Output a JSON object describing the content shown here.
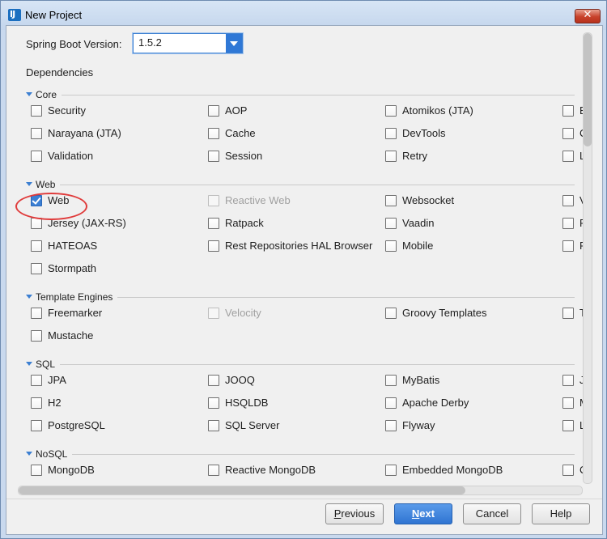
{
  "window": {
    "title": "New Project",
    "icon": "intellij-icon",
    "close_glyph": "✕"
  },
  "spring_boot": {
    "label": "Spring Boot Version:",
    "value": "1.5.2"
  },
  "dependencies_label": "Dependencies",
  "groups": [
    {
      "label": "Core",
      "items": [
        {
          "label": "Security",
          "checked": false,
          "disabled": false
        },
        {
          "label": "AOP",
          "checked": false,
          "disabled": false
        },
        {
          "label": "Atomikos (JTA)",
          "checked": false,
          "disabled": false
        },
        {
          "label": "B",
          "checked": false,
          "disabled": false
        },
        {
          "label": "Narayana (JTA)",
          "checked": false,
          "disabled": false
        },
        {
          "label": "Cache",
          "checked": false,
          "disabled": false
        },
        {
          "label": "DevTools",
          "checked": false,
          "disabled": false
        },
        {
          "label": "C",
          "checked": false,
          "disabled": false
        },
        {
          "label": "Validation",
          "checked": false,
          "disabled": false
        },
        {
          "label": "Session",
          "checked": false,
          "disabled": false
        },
        {
          "label": "Retry",
          "checked": false,
          "disabled": false
        },
        {
          "label": "L",
          "checked": false,
          "disabled": false
        }
      ]
    },
    {
      "label": "Web",
      "items": [
        {
          "label": "Web",
          "checked": true,
          "disabled": false
        },
        {
          "label": "Reactive Web",
          "checked": false,
          "disabled": true
        },
        {
          "label": "Websocket",
          "checked": false,
          "disabled": false
        },
        {
          "label": "V",
          "checked": false,
          "disabled": false
        },
        {
          "label": "Jersey (JAX-RS)",
          "checked": false,
          "disabled": false
        },
        {
          "label": "Ratpack",
          "checked": false,
          "disabled": false
        },
        {
          "label": "Vaadin",
          "checked": false,
          "disabled": false
        },
        {
          "label": "F",
          "checked": false,
          "disabled": false
        },
        {
          "label": "HATEOAS",
          "checked": false,
          "disabled": false
        },
        {
          "label": "Rest Repositories HAL Browser",
          "checked": false,
          "disabled": false
        },
        {
          "label": "Mobile",
          "checked": false,
          "disabled": false
        },
        {
          "label": "F",
          "checked": false,
          "disabled": false
        },
        {
          "label": "Stormpath",
          "checked": false,
          "disabled": false
        }
      ]
    },
    {
      "label": "Template Engines",
      "items": [
        {
          "label": "Freemarker",
          "checked": false,
          "disabled": false
        },
        {
          "label": "Velocity",
          "checked": false,
          "disabled": true
        },
        {
          "label": "Groovy Templates",
          "checked": false,
          "disabled": false
        },
        {
          "label": "T",
          "checked": false,
          "disabled": false
        },
        {
          "label": "Mustache",
          "checked": false,
          "disabled": false
        }
      ]
    },
    {
      "label": "SQL",
      "items": [
        {
          "label": "JPA",
          "checked": false,
          "disabled": false
        },
        {
          "label": "JOOQ",
          "checked": false,
          "disabled": false
        },
        {
          "label": "MyBatis",
          "checked": false,
          "disabled": false
        },
        {
          "label": "J",
          "checked": false,
          "disabled": false
        },
        {
          "label": "H2",
          "checked": false,
          "disabled": false
        },
        {
          "label": "HSQLDB",
          "checked": false,
          "disabled": false
        },
        {
          "label": "Apache Derby",
          "checked": false,
          "disabled": false
        },
        {
          "label": "M",
          "checked": false,
          "disabled": false
        },
        {
          "label": "PostgreSQL",
          "checked": false,
          "disabled": false
        },
        {
          "label": "SQL Server",
          "checked": false,
          "disabled": false
        },
        {
          "label": "Flyway",
          "checked": false,
          "disabled": false
        },
        {
          "label": "L",
          "checked": false,
          "disabled": false
        }
      ]
    },
    {
      "label": "NoSQL",
      "items": [
        {
          "label": "MongoDB",
          "checked": false,
          "disabled": false
        },
        {
          "label": "Reactive MongoDB",
          "checked": false,
          "disabled": false
        },
        {
          "label": "Embedded MongoDB",
          "checked": false,
          "disabled": false
        },
        {
          "label": "C",
          "checked": false,
          "disabled": false
        }
      ]
    }
  ],
  "buttons": {
    "previous": {
      "mnemonic": "P",
      "rest": "revious"
    },
    "next": {
      "mnemonic": "N",
      "rest": "ext"
    },
    "cancel": "Cancel",
    "help": "Help"
  },
  "colors": {
    "accent": "#3b7fd4",
    "highlight_ring": "#e03c3c"
  }
}
